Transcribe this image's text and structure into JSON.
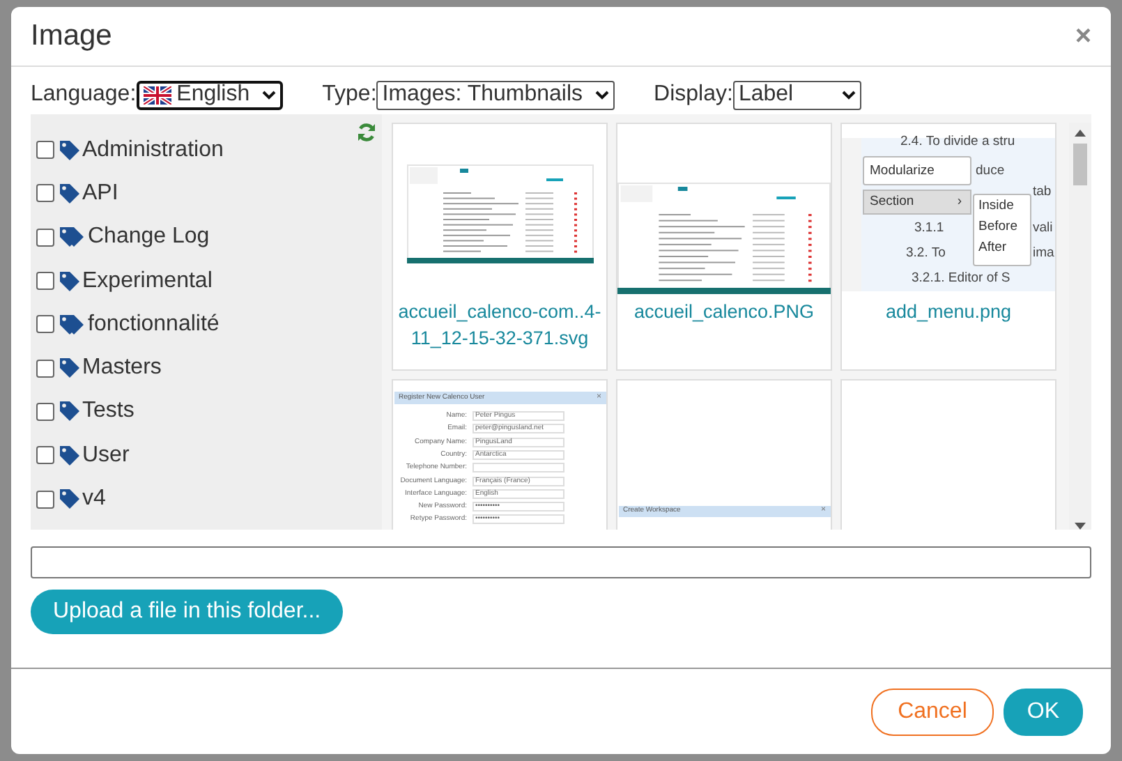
{
  "dialog": {
    "title": "Image",
    "close": "×"
  },
  "filters": [
    {
      "label": "Language:",
      "value": "English",
      "flag": true,
      "focused": true
    },
    {
      "label": "Type:",
      "value": "Images: Thumbnails",
      "flag": false,
      "focused": false
    },
    {
      "label": "Display:",
      "value": "Label",
      "flag": false,
      "focused": false
    }
  ],
  "tags": [
    {
      "label": "Administration",
      "checked": false,
      "kind": "single"
    },
    {
      "label": "API",
      "checked": false,
      "kind": "single"
    },
    {
      "label": "Change Log",
      "checked": false,
      "kind": "multi"
    },
    {
      "label": "Experimental",
      "checked": false,
      "kind": "single"
    },
    {
      "label": "fonctionnalité",
      "checked": false,
      "kind": "multi"
    },
    {
      "label": "Masters",
      "checked": false,
      "kind": "single"
    },
    {
      "label": "Tests",
      "checked": false,
      "kind": "single"
    },
    {
      "label": "User",
      "checked": false,
      "kind": "single"
    },
    {
      "label": "v4",
      "checked": false,
      "kind": "single"
    }
  ],
  "files": [
    {
      "name": "accueil_calenco-com..4-11_12-15-32-371.svg",
      "thumbnail": {
        "kind": "table"
      }
    },
    {
      "name": "accueil_calenco.PNG",
      "thumbnail": {
        "kind": "table-wide"
      }
    },
    {
      "name": "add_menu.png",
      "thumbnail": {
        "kind": "menu",
        "fragments": [
          "2.4. To divide a stru",
          "duce",
          "tab",
          "3.1.1",
          "vali",
          "3.2. To",
          "ima",
          "3.2.1. Editor of S"
        ],
        "menu": [
          "Modularize",
          "Section",
          "›"
        ],
        "submenu": [
          "Inside",
          "Before",
          "After"
        ]
      }
    },
    {
      "thumbnail": {
        "kind": "form",
        "title": "Register New Calenco User",
        "close": "×",
        "fields": [
          {
            "label": "Name:",
            "value": "Peter Pingus"
          },
          {
            "label": "Email:",
            "value": "peter@pingusland.net"
          },
          {
            "label": "Company Name:",
            "value": "PingusLand"
          },
          {
            "label": "Country:",
            "value": "Antarctica"
          },
          {
            "label": "Telephone Number:"
          },
          {
            "label": "Document Language:",
            "value": "Français (France)"
          },
          {
            "label": "Interface Language:",
            "value": "English"
          },
          {
            "label": "New Password:",
            "value": "••••••••••"
          },
          {
            "label": "Retype Password:",
            "value": "••••••••••"
          }
        ]
      }
    },
    {
      "thumbnail": {
        "kind": "dialog",
        "title": "Create Workspace",
        "close": "×"
      }
    },
    {
      "thumbnail": {
        "kind": "blank"
      }
    }
  ],
  "upload_button": "Upload a file in this folder...",
  "buttons": [
    {
      "label": "Cancel",
      "kind": "secondary"
    },
    {
      "label": "OK",
      "kind": "primary"
    }
  ]
}
